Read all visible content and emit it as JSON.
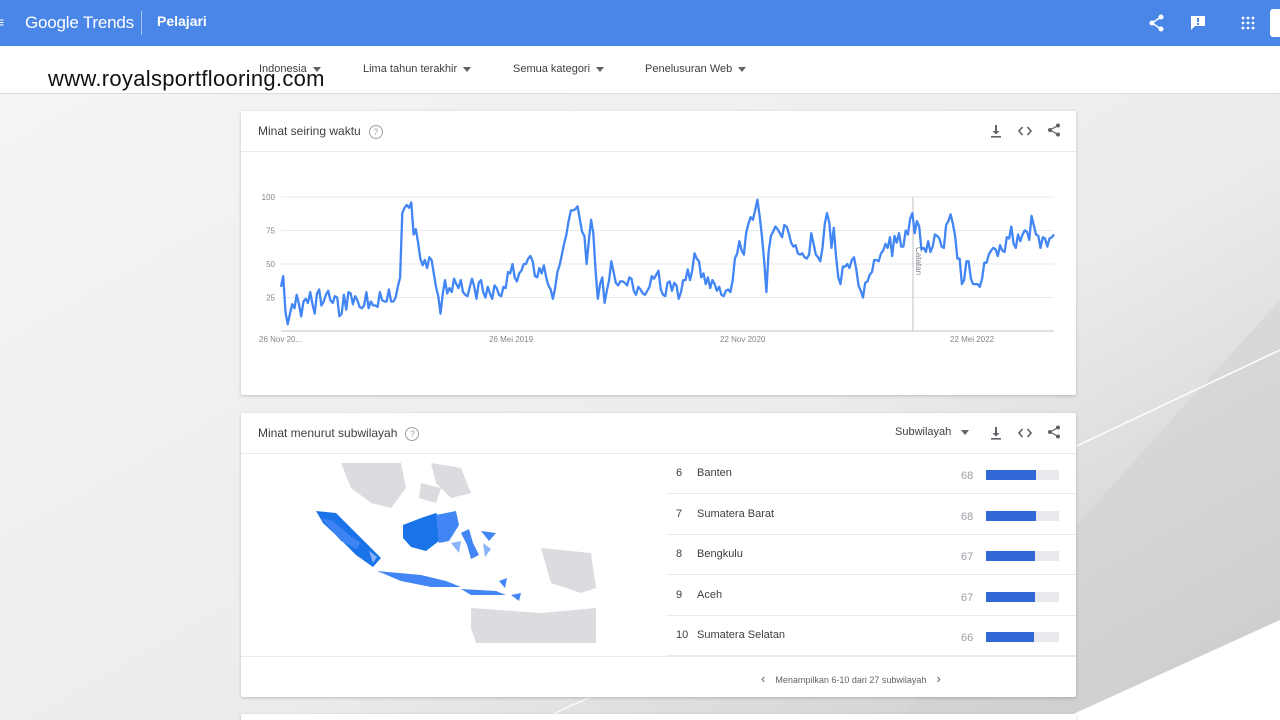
{
  "app": {
    "logo_text": "Google Trends",
    "section": "Pelajari",
    "menu_icon": "≡"
  },
  "watermark": "www.royalsportflooring.com",
  "filters": [
    {
      "label": "Indonesia"
    },
    {
      "label": "Lima tahun terakhir"
    },
    {
      "label": "Semua kategori"
    },
    {
      "label": "Penelusuran Web"
    }
  ],
  "interest_over_time": {
    "title": "Minat seiring waktu",
    "note_label": "Catatan"
  },
  "chart_data": {
    "type": "line",
    "title": "Minat seiring waktu",
    "x_tick_labels": [
      "26 Nov 20...",
      "26 Mei 2019",
      "22 Nov 2020",
      "22 Mei 2022"
    ],
    "x_range": [
      "26 Nov 2017",
      "Nov 2022"
    ],
    "ylim": [
      0,
      100
    ],
    "y_ticks": [
      25,
      50,
      75,
      100
    ],
    "grid": true,
    "color": "#4285f4",
    "annotation": "Catatan",
    "series": [
      {
        "values": [
          33,
          41,
          14,
          5,
          13,
          20,
          17,
          27,
          20,
          11,
          22,
          24,
          21,
          29,
          20,
          13,
          28,
          31,
          19,
          22,
          27,
          30,
          23,
          21,
          26,
          25,
          11,
          13,
          27,
          16,
          29,
          28,
          20,
          26,
          23,
          18,
          17,
          19,
          29,
          17,
          22,
          19,
          19,
          18,
          29,
          23,
          22,
          22,
          31,
          22,
          22,
          25,
          33,
          40,
          88,
          92,
          94,
          92,
          96,
          72,
          76,
          66,
          54,
          49,
          53,
          47,
          55,
          53,
          43,
          33,
          26,
          13,
          28,
          38,
          28,
          32,
          29,
          39,
          35,
          32,
          38,
          29,
          27,
          26,
          33,
          39,
          33,
          24,
          36,
          38,
          29,
          25,
          33,
          28,
          24,
          34,
          32,
          27,
          26,
          33,
          32,
          44,
          43,
          50,
          40,
          37,
          43,
          45,
          50,
          50,
          54,
          56,
          52,
          41,
          40,
          47,
          43,
          49,
          40,
          34,
          31,
          24,
          32,
          44,
          49,
          57,
          65,
          72,
          82,
          90,
          90,
          91,
          93,
          83,
          74,
          71,
          50,
          68,
          83,
          73,
          45,
          24,
          35,
          40,
          21,
          30,
          38,
          52,
          44,
          36,
          34,
          37,
          37,
          36,
          34,
          40,
          39,
          30,
          27,
          33,
          31,
          28,
          27,
          30,
          33,
          41,
          39,
          42,
          45,
          31,
          27,
          26,
          36,
          37,
          30,
          36,
          34,
          24,
          29,
          38,
          38,
          46,
          38,
          45,
          58,
          54,
          52,
          40,
          43,
          35,
          40,
          32,
          38,
          35,
          30,
          33,
          27,
          26,
          30,
          31,
          29,
          38,
          54,
          58,
          67,
          60,
          57,
          73,
          80,
          85,
          83,
          90,
          98,
          86,
          71,
          53,
          29,
          59,
          71,
          74,
          78,
          76,
          73,
          70,
          79,
          78,
          73,
          66,
          63,
          64,
          58,
          57,
          58,
          55,
          54,
          57,
          73,
          65,
          57,
          55,
          52,
          62,
          80,
          88,
          81,
          62,
          77,
          56,
          40,
          35,
          48,
          48,
          50,
          47,
          53,
          55,
          46,
          34,
          30,
          25,
          36,
          37,
          42,
          44,
          53,
          53,
          52,
          58,
          60,
          65,
          62,
          70,
          56,
          71,
          66,
          73,
          63,
          63,
          75,
          72,
          84,
          88,
          73,
          82,
          78,
          61,
          62,
          59,
          67,
          59,
          63,
          72,
          71,
          69,
          63,
          62,
          79,
          82,
          87,
          80,
          71,
          54,
          54,
          35,
          38,
          52,
          52,
          39,
          35,
          35,
          35,
          33,
          39,
          51,
          51,
          57,
          60,
          62,
          61,
          56,
          64,
          60,
          59,
          70,
          69,
          78,
          65,
          62,
          72,
          67,
          72,
          75,
          74,
          68,
          86,
          79,
          72,
          71,
          62,
          70,
          69,
          63,
          69,
          70,
          72
        ]
      }
    ]
  },
  "interest_by_subregion": {
    "title": "Minat menurut subwilayah",
    "dropdown_label": "Subwilayah",
    "rows": [
      {
        "rank": "6",
        "name": "Banten",
        "value": "68",
        "value_num": 68
      },
      {
        "rank": "7",
        "name": "Sumatera Barat",
        "value": "68",
        "value_num": 68
      },
      {
        "rank": "8",
        "name": "Bengkulu",
        "value": "67",
        "value_num": 67
      },
      {
        "rank": "9",
        "name": "Aceh",
        "value": "67",
        "value_num": 67
      },
      {
        "rank": "10",
        "name": "Sumatera Selatan",
        "value": "66",
        "value_num": 66
      }
    ],
    "pager_text": "Menampilkan 6-10 dari 27 subwilayah",
    "map_color": "#1a73e8"
  }
}
